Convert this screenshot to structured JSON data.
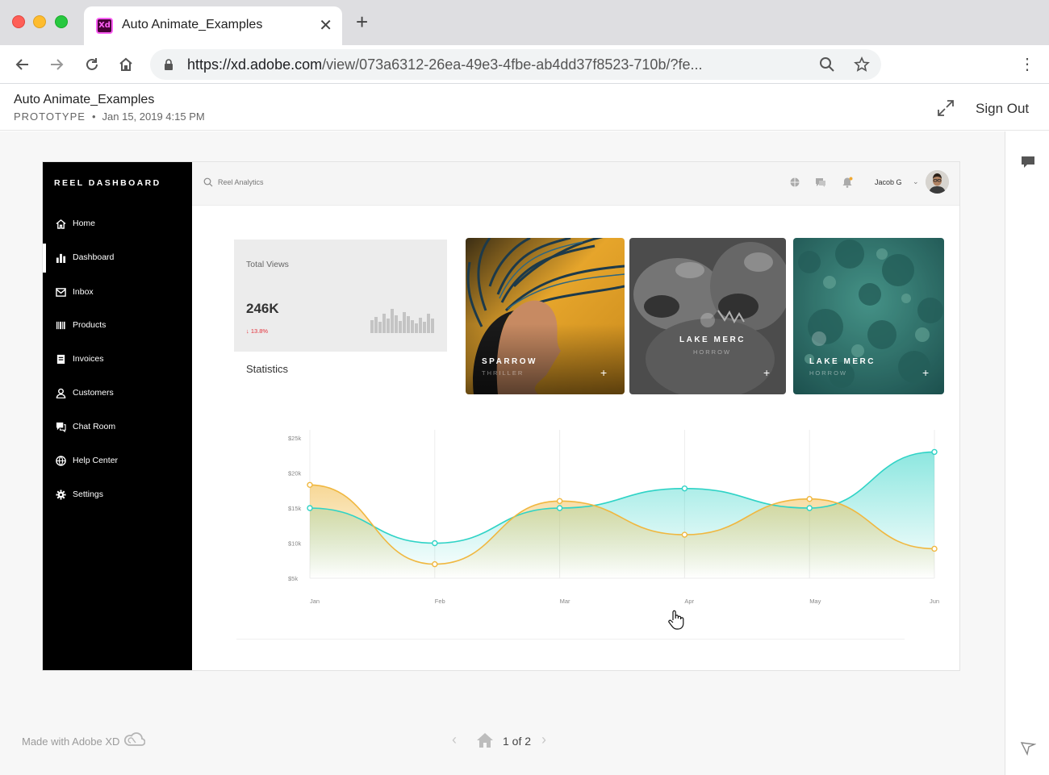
{
  "browser": {
    "tab_title": "Auto Animate_Examples",
    "tab_badge": "Xd",
    "url_host": "https://xd.adobe.com",
    "url_path": "/view/073a6312-26ea-49e3-4fbe-ab4dd37f8523-710b/?fe..."
  },
  "xd_header": {
    "title": "Auto Animate_Examples",
    "kind": "PROTOTYPE",
    "date": "Jan 15, 2019 4:15 PM",
    "sign_out": "Sign Out"
  },
  "app": {
    "brand": "REEL DASHBOARD",
    "nav": [
      {
        "label": "Home",
        "icon": "home-icon"
      },
      {
        "label": "Dashboard",
        "icon": "bar-chart-icon",
        "active": true
      },
      {
        "label": "Inbox",
        "icon": "mail-icon"
      },
      {
        "label": "Products",
        "icon": "barcode-icon"
      },
      {
        "label": "Invoices",
        "icon": "invoice-icon"
      },
      {
        "label": "Customers",
        "icon": "user-icon"
      },
      {
        "label": "Chat Room",
        "icon": "chat-icon"
      },
      {
        "label": "Help Center",
        "icon": "globe-icon"
      },
      {
        "label": "Settings",
        "icon": "gear-icon"
      }
    ],
    "search_placeholder": "Reel Analytics",
    "user_name": "Jacob G",
    "stats": {
      "label": "Total Views",
      "value": "246K",
      "change": "↓ 13.8%"
    },
    "statistics_label": "Statistics",
    "media": [
      {
        "title": "SPARROW",
        "genre": "THRILLER"
      },
      {
        "title": "LAKE MERC",
        "genre": "HORROW"
      },
      {
        "title": "LAKE MERC",
        "genre": "HORROW"
      }
    ],
    "media_add": "+"
  },
  "chart_data": {
    "type": "area",
    "categories": [
      "Jan",
      "Feb",
      "Mar",
      "Apr",
      "May",
      "Jun"
    ],
    "y_ticks": [
      "$5k",
      "$10k",
      "$15k",
      "$20k",
      "$25k"
    ],
    "ylim": [
      5,
      25
    ],
    "series": [
      {
        "color": "#2fd3c6",
        "values": [
          15,
          10,
          15,
          17.8,
          15,
          23
        ]
      },
      {
        "color": "#f0b73f",
        "values": [
          18.3,
          7,
          16,
          11.2,
          16.3,
          9.2
        ]
      }
    ],
    "grid": true
  },
  "footer": {
    "made_with": "Made with Adobe XD",
    "page": "1 of 2"
  },
  "colors": {
    "accent_teal": "#2fd3c6",
    "accent_orange": "#f0b73f",
    "sidebar_bg": "#000000",
    "down_red": "#e4303a"
  }
}
